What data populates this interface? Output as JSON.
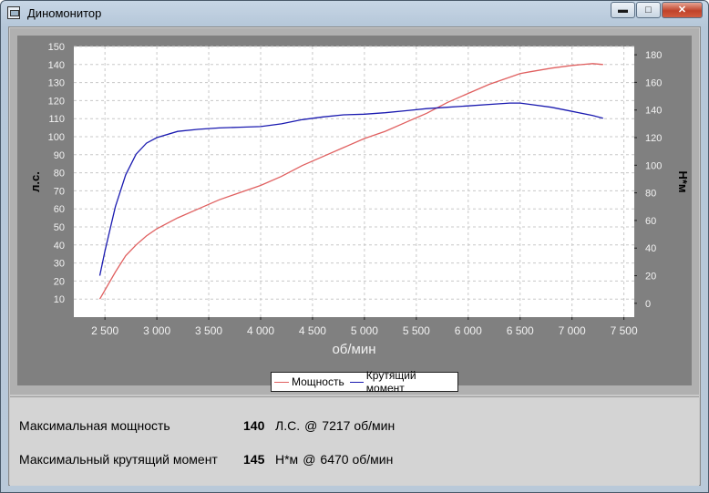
{
  "window": {
    "title": "Диномонитор",
    "buttons": {
      "minimize": "▬",
      "maximize": "□",
      "close": "✕"
    }
  },
  "chart_data": {
    "type": "line",
    "xlabel": "об/мин",
    "ylabel_left": "л.с.",
    "ylabel_right": "Н*м",
    "xlim": [
      2200,
      7600
    ],
    "ylim_left": [
      0,
      150
    ],
    "ylim_right": [
      -10,
      186
    ],
    "x_ticks": [
      2500,
      3000,
      3500,
      4000,
      4500,
      5000,
      5500,
      6000,
      6500,
      7000,
      7500
    ],
    "x_tick_labels": [
      "2 500",
      "3 000",
      "3 500",
      "4 000",
      "4 500",
      "5 000",
      "5 500",
      "6 000",
      "6 500",
      "7 000",
      "7 500"
    ],
    "y_left_ticks": [
      10,
      20,
      30,
      40,
      50,
      60,
      70,
      80,
      90,
      100,
      110,
      120,
      130,
      140,
      150
    ],
    "y_right_ticks": [
      0,
      20,
      40,
      60,
      80,
      100,
      120,
      140,
      160,
      180
    ],
    "grid": true,
    "legend_placement": "bottom-center",
    "series": [
      {
        "name": "Мощность",
        "axis": "left",
        "color": "#e06060",
        "x": [
          2450,
          2500,
          2600,
          2700,
          2800,
          2900,
          3000,
          3200,
          3400,
          3600,
          3800,
          4000,
          4200,
          4400,
          4600,
          4800,
          5000,
          5200,
          5400,
          5600,
          5800,
          6000,
          6200,
          6400,
          6500,
          6600,
          6800,
          7000,
          7200,
          7300
        ],
        "values": [
          10,
          15,
          25,
          34,
          40,
          45,
          49,
          55,
          60,
          65,
          69,
          73,
          78,
          84,
          89,
          94,
          99,
          103,
          108,
          113,
          119,
          124,
          129,
          133,
          135,
          136,
          138,
          139.5,
          140.5,
          140
        ]
      },
      {
        "name": "Крутящий момент",
        "axis": "right",
        "color": "#1a1ab0",
        "x": [
          2450,
          2500,
          2600,
          2700,
          2800,
          2900,
          3000,
          3200,
          3400,
          3600,
          3800,
          4000,
          4200,
          4400,
          4600,
          4800,
          5000,
          5200,
          5400,
          5600,
          5800,
          6000,
          6200,
          6400,
          6500,
          6600,
          6800,
          7000,
          7200,
          7300
        ],
        "values": [
          20,
          38,
          70,
          93,
          108,
          116,
          120,
          124.5,
          126,
          127,
          127.5,
          128,
          130,
          133,
          135,
          136.5,
          137,
          138,
          139.5,
          141,
          142,
          143,
          144,
          145,
          145,
          144,
          142,
          139,
          136,
          134
        ]
      }
    ]
  },
  "summary": {
    "max_power": {
      "label": "Максимальная мощность",
      "value": "140",
      "unit": "Л.С.",
      "at": "@",
      "rpm": "7217 об/мин"
    },
    "max_torque": {
      "label": "Максимальный крутящий момент",
      "value": "145",
      "unit": "Н*м",
      "at": "@",
      "rpm": "6470 об/мин"
    }
  }
}
